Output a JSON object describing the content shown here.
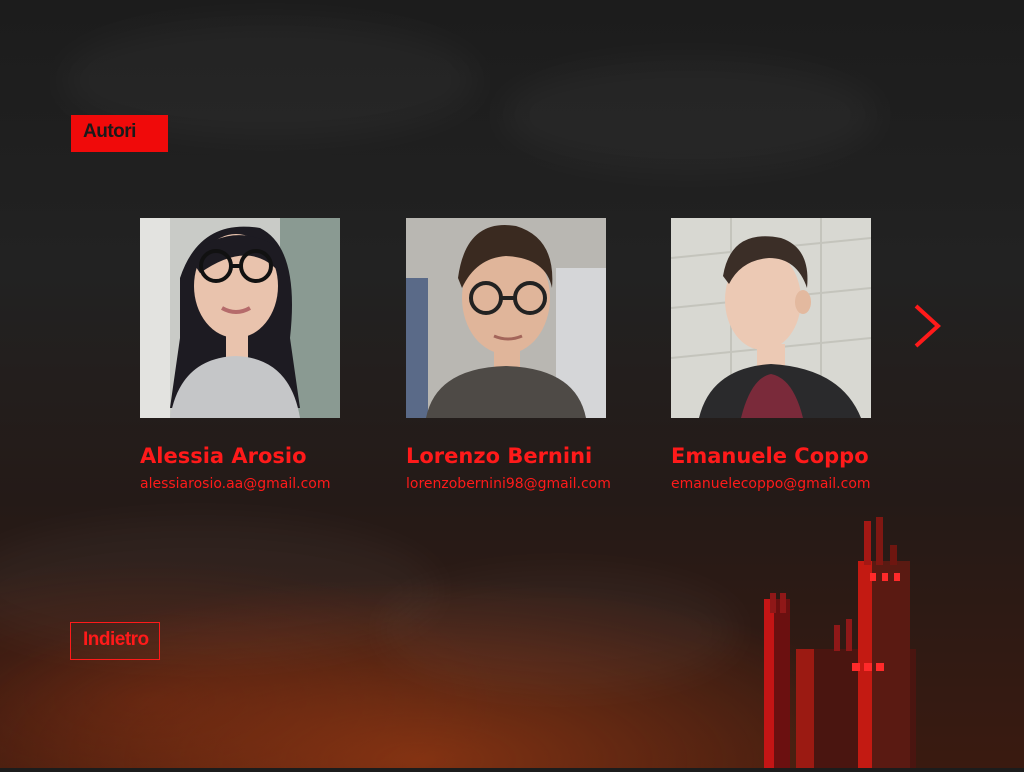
{
  "header": {
    "title": "Autori"
  },
  "authors": [
    {
      "name": "Alessia Arosio",
      "email": "alessiarosio.aa@gmail.com"
    },
    {
      "name": "Lorenzo Bernini",
      "email": "lorenzobernini98@gmail.com"
    },
    {
      "name": "Emanuele Coppo",
      "email": "emanuelecoppo@gmail.com"
    }
  ],
  "navigation": {
    "next_icon": "chevron-right-icon",
    "back_label": "Indietro"
  },
  "colors": {
    "accent": "#ff1a1a",
    "tag_background": "#f00a0a",
    "background": "#1f1f1f"
  }
}
